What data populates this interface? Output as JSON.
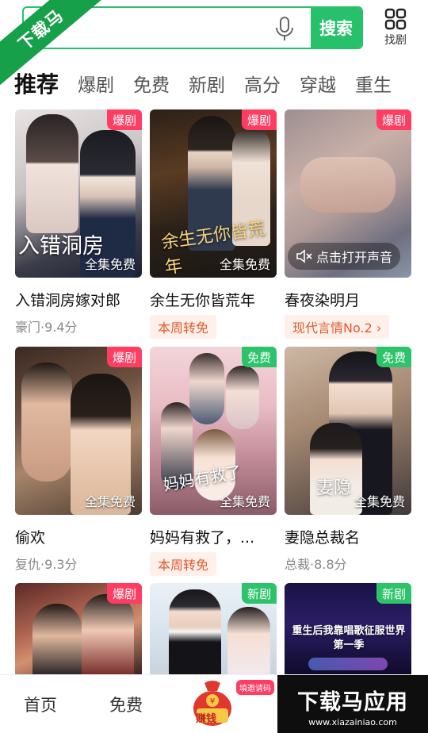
{
  "watermark": {
    "ribbon": "下载马",
    "brand": "下载马应用",
    "url": "www.xiazainiao.com"
  },
  "search": {
    "button_label": "搜索",
    "find_label": "找剧"
  },
  "tabs": [
    "推荐",
    "爆剧",
    "免费",
    "新剧",
    "高分",
    "穿越",
    "重生"
  ],
  "cards": [
    {
      "badge": "爆剧",
      "foot": "全集免费",
      "overlay": "入错洞房",
      "title": "入错洞房嫁对郎",
      "sub": "豪门·9.4分"
    },
    {
      "badge": "爆剧",
      "foot": "全集免费",
      "overlay": "余生无你皆荒年",
      "title": "余生无你皆荒年",
      "pill": "本周转免"
    },
    {
      "badge": "爆剧",
      "sound": "点击打开声音",
      "title": "春夜染明月",
      "pill": "现代言情No.2 ›"
    },
    {
      "badge": "爆剧",
      "foot": "全集免费",
      "title": "偷欢",
      "sub": "复仇·9.3分"
    },
    {
      "badge": "免费",
      "foot": "全集免费",
      "overlay": "妈妈有救了",
      "title": "妈妈有救了，...",
      "pill": "本周转免"
    },
    {
      "badge": "免费",
      "foot": "全集免费",
      "overlay": "妻隐",
      "title": "妻隐总裁名",
      "sub": "总裁·8.8分"
    },
    {
      "badge": "爆剧"
    },
    {
      "badge": "新剧"
    },
    {
      "badge": "新剧",
      "overlay": "重生后我靠唱歌征服世界 第一季"
    }
  ],
  "bottom_nav": {
    "home": "首页",
    "free": "免费",
    "earn": "赚钱",
    "invite": "填邀请码"
  },
  "colors": {
    "accent_green": "#27c16c",
    "hot_badge": "#ff3d63",
    "free_badge": "#2dc36a",
    "pill_text": "#e05a33"
  }
}
